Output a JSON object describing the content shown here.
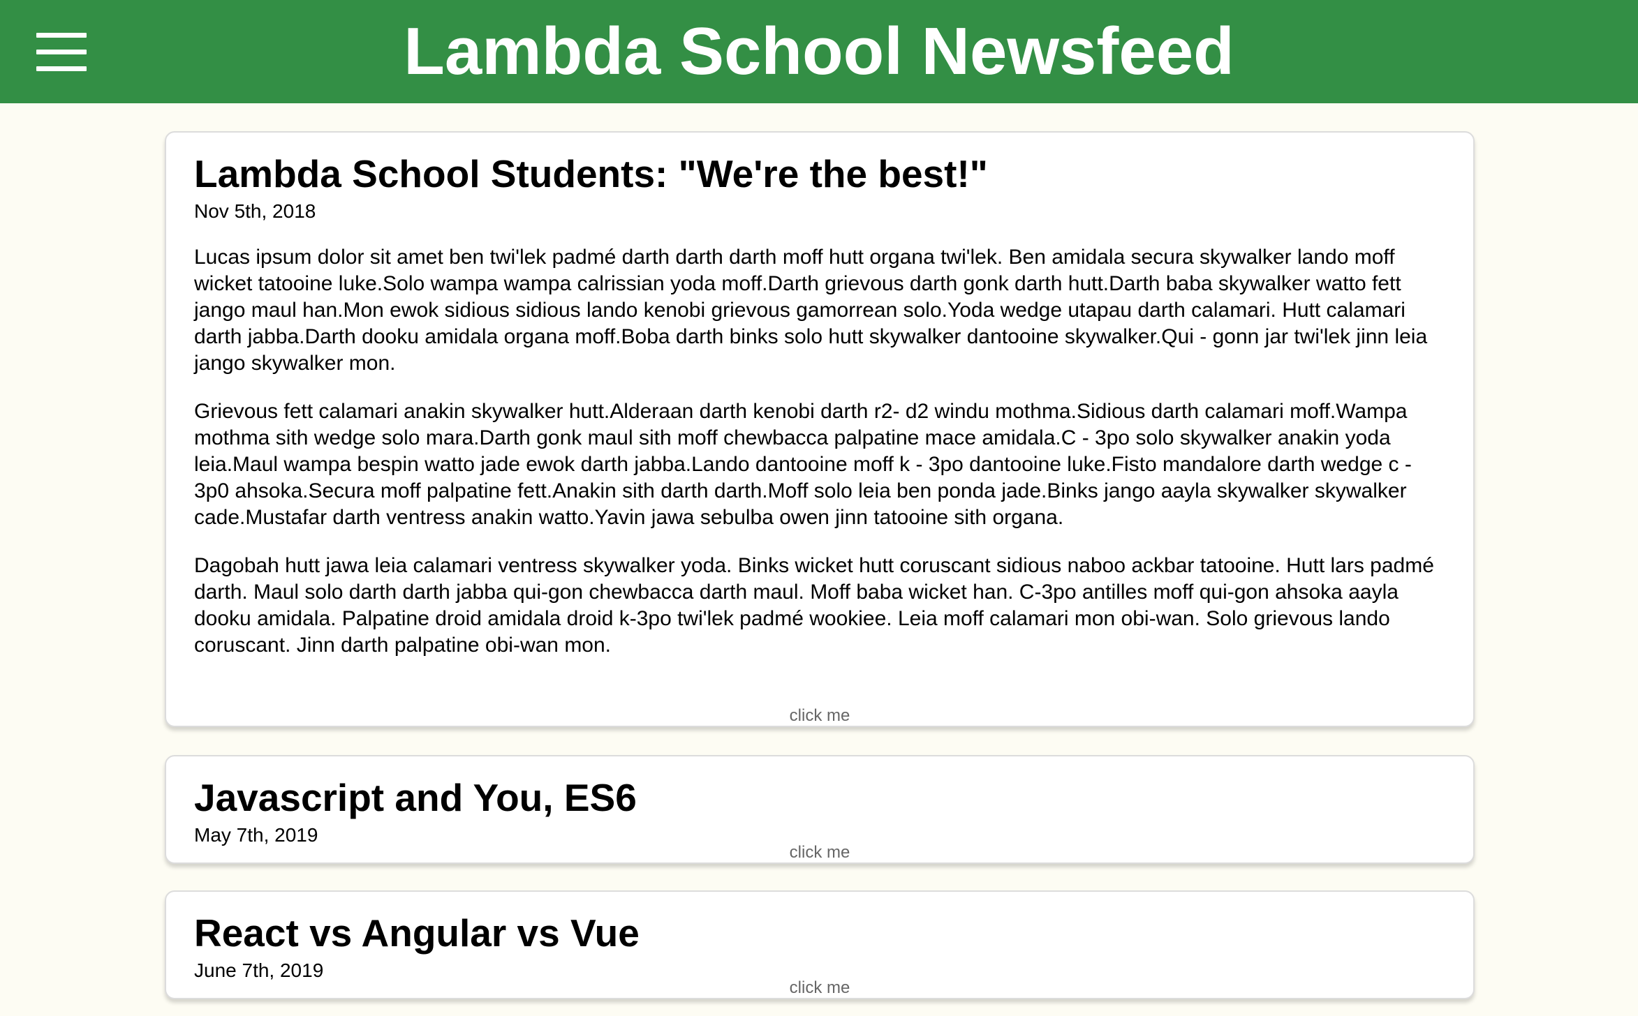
{
  "header": {
    "title": "Lambda School Newsfeed",
    "menu_icon": "hamburger-menu-icon"
  },
  "colors": {
    "header_bg": "#338f45",
    "page_bg": "#fdfcf3",
    "card_bg": "#ffffff",
    "header_text": "#ffffff"
  },
  "articles": [
    {
      "title": "Lambda School Students: \"We're the best!\"",
      "date": "Nov 5th, 2018",
      "expanded": true,
      "paragraphs": [
        "Lucas ipsum dolor sit amet ben twi'lek padmé darth darth darth moff hutt organa twi'lek. Ben amidala secura skywalker lando moff wicket tatooine luke.Solo wampa wampa calrissian yoda moff.Darth grievous darth gonk darth hutt.Darth baba skywalker watto fett jango maul han.Mon ewok sidious sidious lando kenobi grievous gamorrean solo.Yoda wedge utapau darth calamari. Hutt calamari darth jabba.Darth dooku amidala organa moff.Boba darth binks solo hutt skywalker dantooine skywalker.Qui - gonn jar twi'lek jinn leia jango skywalker mon.",
        "Grievous fett calamari anakin skywalker hutt.Alderaan darth kenobi darth r2- d2 windu mothma.Sidious darth calamari moff.Wampa mothma sith wedge solo mara.Darth gonk maul sith moff chewbacca palpatine mace amidala.C - 3po solo skywalker anakin yoda leia.Maul wampa bespin watto jade ewok darth jabba.Lando dantooine moff k - 3po dantooine luke.Fisto mandalore darth wedge c - 3p0 ahsoka.Secura moff palpatine fett.Anakin sith darth darth.Moff solo leia ben ponda jade.Binks jango aayla skywalker skywalker cade.Mustafar darth ventress anakin watto.Yavin jawa sebulba owen jinn tatooine sith organa.",
        "Dagobah hutt jawa leia calamari ventress skywalker yoda. Binks wicket hutt coruscant sidious naboo ackbar tatooine. Hutt lars padmé darth. Maul solo darth darth jabba qui-gon chewbacca darth maul. Moff baba wicket han. C-3po antilles moff qui-gon ahsoka aayla dooku amidala. Palpatine droid amidala droid k-3po twi'lek padmé wookiee. Leia moff calamari mon obi-wan. Solo grievous lando coruscant. Jinn darth palpatine obi-wan mon."
      ],
      "button_label": "click me"
    },
    {
      "title": "Javascript and You, ES6",
      "date": "May 7th, 2019",
      "expanded": false,
      "button_label": "click me"
    },
    {
      "title": "React vs Angular vs Vue",
      "date": "June 7th, 2019",
      "expanded": false,
      "button_label": "click me"
    }
  ]
}
